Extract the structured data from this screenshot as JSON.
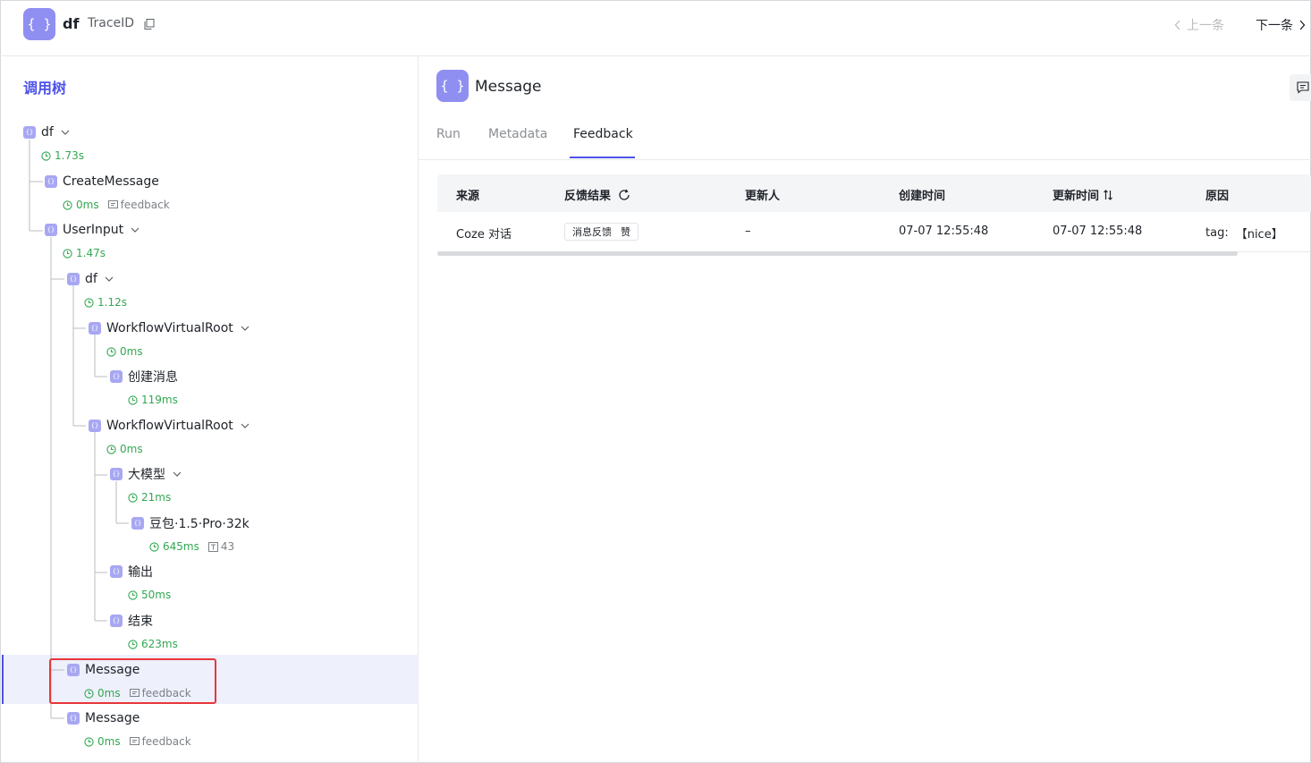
{
  "header": {
    "logo_text": "{ }",
    "trace_name": "df",
    "trace_label": "TraceID",
    "prev_label": "上一条",
    "next_label": "下一条"
  },
  "tree": {
    "title": "调用树",
    "nodes": [
      {
        "name": "df",
        "duration": "1.73s"
      },
      {
        "name": "CreateMessage",
        "duration": "0ms",
        "extra": "feedback"
      },
      {
        "name": "UserInput",
        "duration": "1.47s"
      },
      {
        "name": "df",
        "duration": "1.12s"
      },
      {
        "name": "WorkflowVirtualRoot",
        "duration": "0ms"
      },
      {
        "name": "创建消息",
        "duration": "119ms"
      },
      {
        "name": "WorkflowVirtualRoot",
        "duration": "0ms"
      },
      {
        "name": "大模型",
        "duration": "21ms"
      },
      {
        "name": "豆包·1.5·Pro·32k",
        "duration": "645ms",
        "tokens": "43"
      },
      {
        "name": "输出",
        "duration": "50ms"
      },
      {
        "name": "结束",
        "duration": "623ms"
      },
      {
        "name": "Message",
        "duration": "0ms",
        "extra": "feedback"
      },
      {
        "name": "Message",
        "duration": "0ms",
        "extra": "feedback"
      }
    ]
  },
  "detail": {
    "logo_text": "{ }",
    "title": "Message",
    "tabs": [
      "Run",
      "Metadata",
      "Feedback"
    ],
    "active_tab": "Feedback",
    "table": {
      "headers": [
        "来源",
        "反馈结果",
        "更新人",
        "创建时间",
        "更新时间",
        "原因"
      ],
      "rows": [
        {
          "source": "Coze 对话",
          "result_type": "消息反馈",
          "result_value": "赞",
          "updater": "–",
          "created": "07-07 12:55:48",
          "updated": "07-07 12:55:48",
          "reason_label": "tag:",
          "reason_value": "【nice】"
        }
      ]
    }
  },
  "colors": {
    "accent": "#4d53e8",
    "icon_bg": "#a8a7f2",
    "duration_green": "#33a852",
    "selection_red": "#e8363a"
  }
}
